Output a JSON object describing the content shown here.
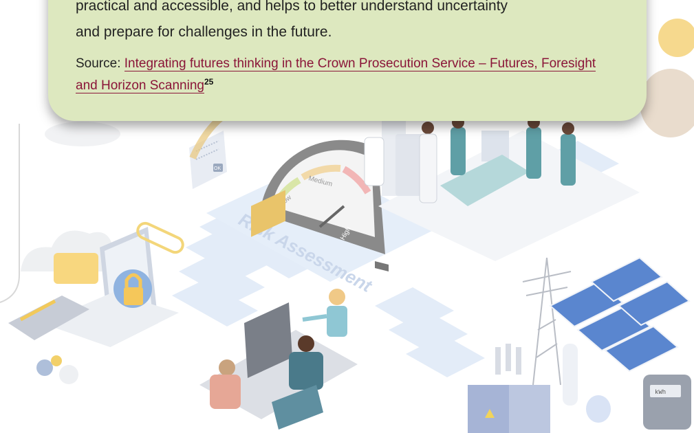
{
  "callout": {
    "line1": "practical and accessible, and helps to better understand uncertainty",
    "line2": "and prepare for challenges in the future.",
    "source_prefix": "Source: ",
    "source_link_text": "Integrating futures thinking in the Crown Prosecution Service – Futures, Foresight and Horizon Scanning",
    "footnote": "25"
  },
  "illustration": {
    "gauge_title": "Risk Assessment",
    "gauge_low": "Low",
    "gauge_medium": "Medium",
    "gauge_high": "High",
    "ok_label": "OK",
    "meter_label": "kWh"
  },
  "colors": {
    "callout_bg": "#dde8bf",
    "link": "#8a1538",
    "platform": "#dfe9f7",
    "solar_panel": "#4a78c7",
    "gauge_body": "#6f6f6f"
  }
}
